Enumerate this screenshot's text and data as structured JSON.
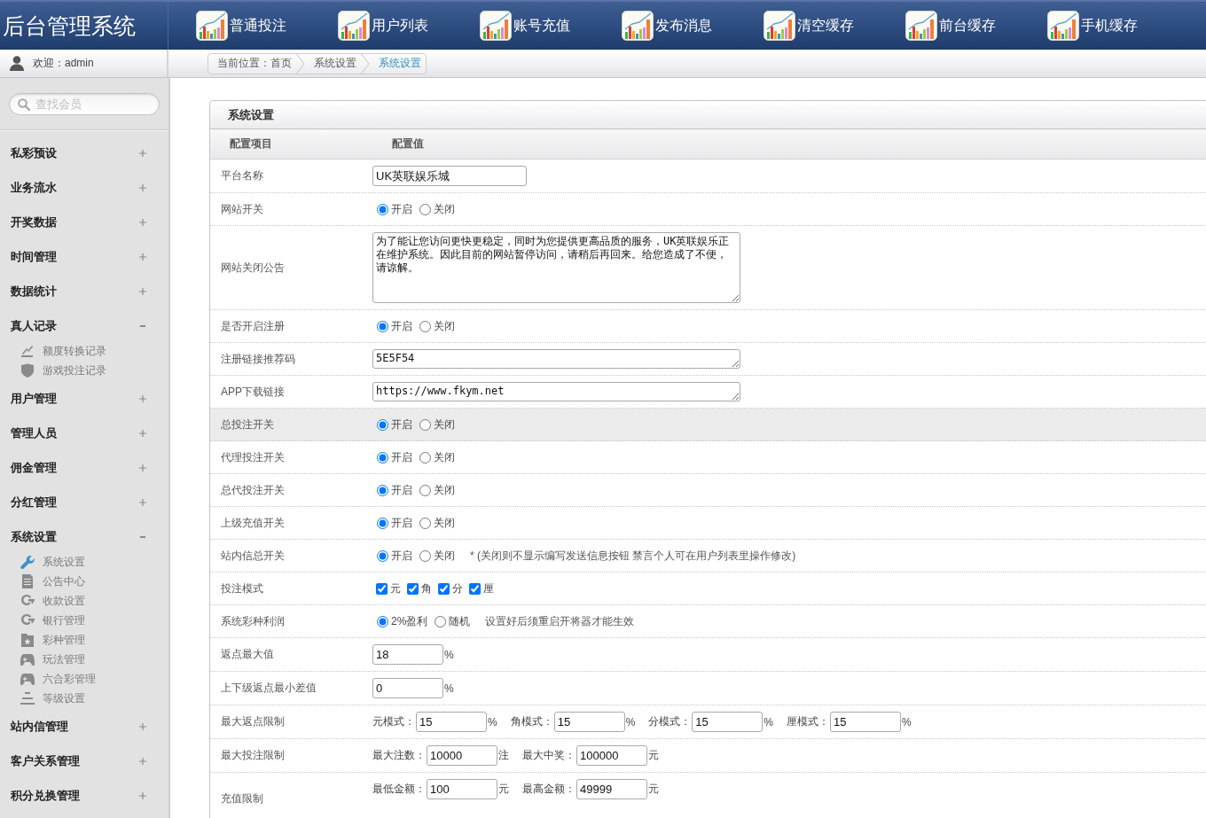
{
  "header": {
    "title": "后台管理系统",
    "nav": [
      "普通投注",
      "用户列表",
      "账号充值",
      "发布消息",
      "清空缓存",
      "前台缓存",
      "手机缓存"
    ]
  },
  "user_bar": {
    "welcome": "欢迎：admin"
  },
  "breadcrumb": [
    {
      "label": "当前位置：首页",
      "selected": false
    },
    {
      "label": "系统设置",
      "selected": false
    },
    {
      "label": "系统设置",
      "selected": true
    }
  ],
  "sidebar": {
    "search": {
      "placeholder": "查找会员"
    },
    "items": [
      {
        "label": "私彩预设",
        "expanded": false
      },
      {
        "label": "业务流水",
        "expanded": false
      },
      {
        "label": "开奖数据",
        "expanded": false
      },
      {
        "label": "时间管理",
        "expanded": false
      },
      {
        "label": "数据统计",
        "expanded": false
      },
      {
        "label": "真人记录",
        "expanded": true,
        "children": [
          {
            "label": "额度转换记录",
            "selected": false
          },
          {
            "label": "游戏投注记录",
            "selected": false
          }
        ]
      },
      {
        "label": "用户管理",
        "expanded": false
      },
      {
        "label": "管理人员",
        "expanded": false
      },
      {
        "label": "佣金管理",
        "expanded": false
      },
      {
        "label": "分红管理",
        "expanded": false
      },
      {
        "label": "系统设置",
        "expanded": true,
        "children": [
          {
            "label": "系统设置",
            "selected": true
          },
          {
            "label": "公告中心",
            "selected": false
          },
          {
            "label": "收款设置",
            "selected": false
          },
          {
            "label": "银行管理",
            "selected": false
          },
          {
            "label": "彩种管理",
            "selected": false
          },
          {
            "label": "玩法管理",
            "selected": false
          },
          {
            "label": "六合彩管理",
            "selected": false
          },
          {
            "label": "等级设置",
            "selected": false
          }
        ]
      },
      {
        "label": "站内信管理",
        "expanded": false
      },
      {
        "label": "客户关系管理",
        "expanded": false
      },
      {
        "label": "积分兑换管理",
        "expanded": false
      }
    ]
  },
  "panel": {
    "title": "系统设置",
    "columns": [
      "配置项目",
      "配置值"
    ],
    "rows": [
      {
        "label": "平台名称",
        "kind": "text",
        "highlighted": false,
        "value": "UK英联娱乐城"
      },
      {
        "label": "网站开关",
        "kind": "radio",
        "highlighted": false,
        "options": [
          {
            "label": "开启",
            "selected": true
          },
          {
            "label": "关闭",
            "selected": false
          }
        ]
      },
      {
        "label": "网站关闭公告",
        "kind": "textarea",
        "highlighted": false,
        "value": "为了能让您访问更快更稳定，同时为您提供更高品质的服务，UK英联娱乐正在维护系统。因此目前的网站暂停访问，请稍后再回来。给您造成了不便，请谅解。"
      },
      {
        "label": "是否开启注册",
        "kind": "radio",
        "highlighted": false,
        "options": [
          {
            "label": "开启",
            "selected": true
          },
          {
            "label": "关闭",
            "selected": false
          }
        ]
      },
      {
        "label": "注册链接推荐码",
        "kind": "textline",
        "highlighted": false,
        "value": "5E5F54"
      },
      {
        "label": "APP下载链接",
        "kind": "textline",
        "highlighted": false,
        "value": "https://www.fkym.net"
      },
      {
        "label": "总投注开关",
        "kind": "radio",
        "highlighted": true,
        "options": [
          {
            "label": "开启",
            "selected": true
          },
          {
            "label": "关闭",
            "selected": false
          }
        ]
      },
      {
        "label": "代理投注开关",
        "kind": "radio",
        "highlighted": false,
        "options": [
          {
            "label": "开启",
            "selected": true
          },
          {
            "label": "关闭",
            "selected": false
          }
        ]
      },
      {
        "label": "总代投注开关",
        "kind": "radio",
        "highlighted": false,
        "options": [
          {
            "label": "开启",
            "selected": true
          },
          {
            "label": "关闭",
            "selected": false
          }
        ]
      },
      {
        "label": "上级充值开关",
        "kind": "radio",
        "highlighted": false,
        "options": [
          {
            "label": "开启",
            "selected": true
          },
          {
            "label": "关闭",
            "selected": false
          }
        ]
      },
      {
        "label": "站内信总开关",
        "kind": "radio",
        "highlighted": false,
        "options": [
          {
            "label": "开启",
            "selected": true
          },
          {
            "label": "关闭",
            "selected": false
          }
        ],
        "note": "* (关闭则不显示编写发送信息按钮 禁言个人可在用户列表里操作修改)"
      },
      {
        "label": "投注模式",
        "kind": "checkbox",
        "highlighted": false,
        "options": [
          {
            "label": "元",
            "checked": true
          },
          {
            "label": "角",
            "checked": true
          },
          {
            "label": "分",
            "checked": true
          },
          {
            "label": "厘",
            "checked": true
          }
        ]
      },
      {
        "label": "系统彩种利润",
        "kind": "radio",
        "highlighted": false,
        "options": [
          {
            "label": "2%盈利",
            "selected": true
          },
          {
            "label": "随机",
            "selected": false
          }
        ],
        "note": "设置好后须重启开将器才能生效"
      },
      {
        "label": "返点最大值",
        "kind": "fields",
        "highlighted": false,
        "fields": [
          {
            "value": "18",
            "unit": "%"
          }
        ]
      },
      {
        "label": "上下级返点最小差值",
        "kind": "fields",
        "highlighted": false,
        "fields": [
          {
            "value": "0",
            "unit": "%"
          }
        ]
      },
      {
        "label": "最大返点限制",
        "kind": "fields",
        "highlighted": false,
        "fields": [
          {
            "label": "元模式：",
            "value": "15",
            "unit": "%"
          },
          {
            "label": "角模式：",
            "value": "15",
            "unit": "%"
          },
          {
            "label": "分模式：",
            "value": "15",
            "unit": "%"
          },
          {
            "label": "厘模式：",
            "value": "15",
            "unit": "%"
          }
        ]
      },
      {
        "label": "最大投注限制",
        "kind": "fields",
        "highlighted": false,
        "fields": [
          {
            "label": "最大注数：",
            "value": "10000",
            "unit": "注"
          },
          {
            "label": "最大中奖：",
            "value": "100000",
            "unit": "元"
          }
        ]
      },
      {
        "label": "充值限制",
        "kind": "fields",
        "highlighted": false,
        "fields": [
          {
            "label": "最低金额：",
            "value": "100",
            "unit": "元"
          },
          {
            "label": "最高金额：",
            "value": "49999",
            "unit": "元"
          }
        ]
      }
    ]
  }
}
